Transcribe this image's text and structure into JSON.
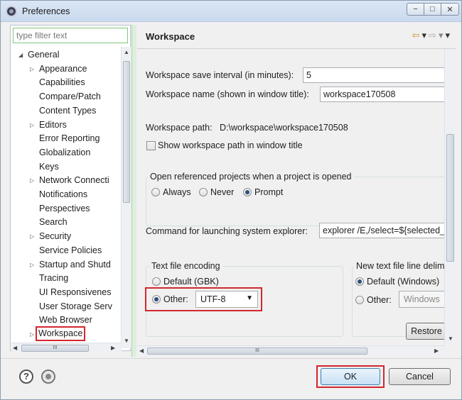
{
  "window": {
    "title": "Preferences",
    "min_glyph": "−",
    "max_glyph": "□",
    "close_glyph": "✕"
  },
  "left": {
    "filter_placeholder": "type filter text",
    "tree": [
      {
        "label": "General",
        "level": 0,
        "twist": "◢"
      },
      {
        "label": "Appearance",
        "level": 1,
        "twist": "▷"
      },
      {
        "label": "Capabilities",
        "level": 1,
        "twist": ""
      },
      {
        "label": "Compare/Patch",
        "level": 1,
        "twist": ""
      },
      {
        "label": "Content Types",
        "level": 1,
        "twist": ""
      },
      {
        "label": "Editors",
        "level": 1,
        "twist": "▷"
      },
      {
        "label": "Error Reporting",
        "level": 1,
        "twist": ""
      },
      {
        "label": "Globalization",
        "level": 1,
        "twist": ""
      },
      {
        "label": "Keys",
        "level": 1,
        "twist": ""
      },
      {
        "label": "Network Connecti",
        "level": 1,
        "twist": "▷"
      },
      {
        "label": "Notifications",
        "level": 1,
        "twist": ""
      },
      {
        "label": "Perspectives",
        "level": 1,
        "twist": ""
      },
      {
        "label": "Search",
        "level": 1,
        "twist": ""
      },
      {
        "label": "Security",
        "level": 1,
        "twist": "▷"
      },
      {
        "label": "Service Policies",
        "level": 1,
        "twist": ""
      },
      {
        "label": "Startup and Shutd",
        "level": 1,
        "twist": "▷"
      },
      {
        "label": "Tracing",
        "level": 1,
        "twist": ""
      },
      {
        "label": "UI Responsivenes",
        "level": 1,
        "twist": ""
      },
      {
        "label": "User Storage Serv",
        "level": 1,
        "twist": ""
      },
      {
        "label": "Web Browser",
        "level": 1,
        "twist": ""
      },
      {
        "label": "Workspace",
        "level": 1,
        "twist": "▷",
        "selected": true
      }
    ],
    "scroll_up": "▲",
    "scroll_down": "▼",
    "scroll_left": "◀",
    "scroll_right": "▶",
    "thumb_grip": "III"
  },
  "right": {
    "page_title": "Workspace",
    "nav_back": "⇦",
    "nav_forward": "⇨",
    "nav_menu": "▾",
    "save_interval_label": "Workspace save interval (in minutes):",
    "save_interval_value": "5",
    "workspace_name_label": "Workspace name (shown in window title):",
    "workspace_name_value": "workspace170508",
    "workspace_path_label": "Workspace path:",
    "workspace_path_value": "D:\\workspace\\workspace170508",
    "show_path_label": "Show workspace path in window title",
    "open_projects_legend": "Open referenced projects when a project is opened",
    "open_always": "Always",
    "open_never": "Never",
    "open_prompt": "Prompt",
    "explorer_label": "Command for launching system explorer:",
    "explorer_value": "explorer /E,/select=${selected_",
    "encoding_legend": "Text file encoding",
    "encoding_default": "Default (GBK)",
    "encoding_other": "Other:",
    "encoding_value": "UTF-8",
    "line_delim_legend": "New text file line delim",
    "line_default": "Default (Windows)",
    "line_other": "Other:",
    "line_other_value": "Windows",
    "restore_label": "Restore"
  },
  "bottom": {
    "help_glyph": "?",
    "ok_label": "OK",
    "cancel_label": "Cancel"
  },
  "colors": {
    "highlight": "#d2272e",
    "sash": "#a6d7a6"
  }
}
